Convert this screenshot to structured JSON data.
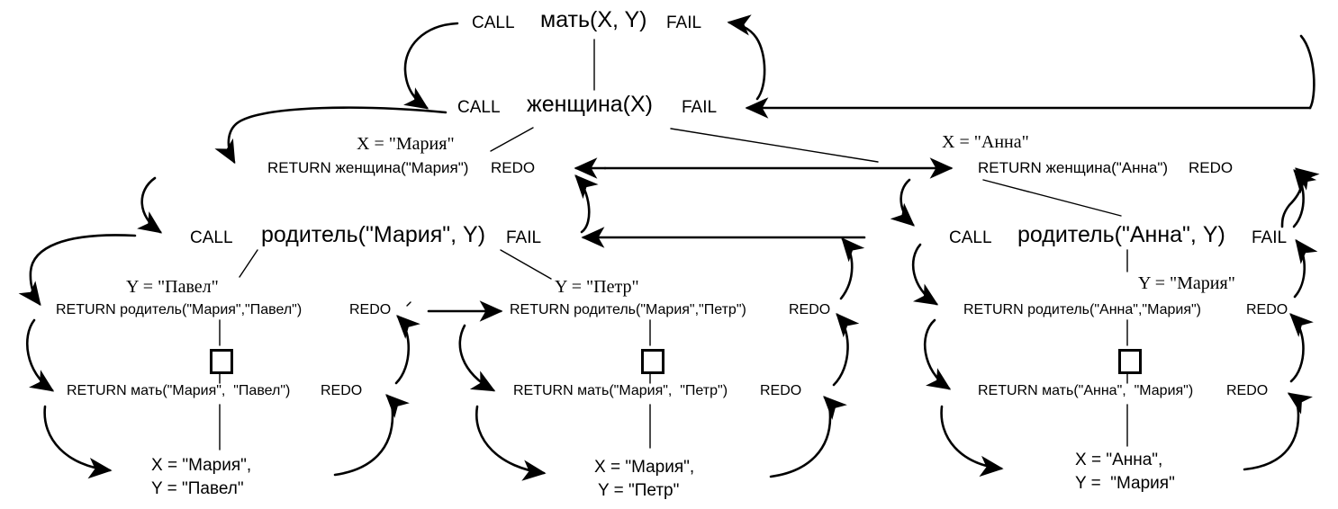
{
  "diagram": {
    "title": "Prolog backtracking execution trace for мать(X, Y)",
    "stroke_color": "#000000",
    "background_color": "#ffffff"
  },
  "keywords": {
    "call": "CALL",
    "fail": "FAIL",
    "redo": "REDO",
    "return": "RETURN"
  },
  "levels": {
    "root": {
      "call": "CALL",
      "goal": "мать(X, Y)",
      "fail": "FAIL"
    },
    "female": {
      "call": "CALL",
      "goal": "женщина(X)",
      "fail": "FAIL"
    }
  },
  "branches": {
    "maria": {
      "binding_x": "X = \"Мария\"",
      "return_female": "RETURN женщина(\"Мария\")",
      "redo_female": "REDO",
      "call": "CALL",
      "goal_parent": "родитель(\"Мария\", Y)",
      "fail_parent": "FAIL",
      "solutions": [
        {
          "binding_y": "Y = \"Павел\"",
          "return_parent": "RETURN родитель(\"Мария\",\"Павел\")",
          "redo_parent": "REDO",
          "return_mother": "RETURN мать(\"Мария\",  \"Павел\")",
          "redo_mother": "REDO",
          "result_line1": "X = \"Мария\",",
          "result_line2": "Y = \"Павел\"",
          "success_box": "empty-goal-box"
        },
        {
          "binding_y": "Y = \"Петр\"",
          "return_parent": "RETURN родитель(\"Мария\",\"Петр\")",
          "redo_parent": "REDO",
          "return_mother": "RETURN мать(\"Мария\",  \"Петр\")",
          "redo_mother": "REDO",
          "result_line1": "X = \"Мария\",",
          "result_line2": "Y = \"Петр\"",
          "success_box": "empty-goal-box"
        }
      ]
    },
    "anna": {
      "binding_x": "X = \"Анна\"",
      "return_female": "RETURN женщина(\"Анна\")",
      "redo_female": "REDO",
      "call": "CALL",
      "goal_parent": "родитель(\"Анна\", Y)",
      "fail_parent": "FAIL",
      "solutions": [
        {
          "binding_y": "Y = \"Мария\"",
          "return_parent": "RETURN родитель(\"Анна\",\"Мария\")",
          "redo_parent": "REDO",
          "return_mother": "RETURN мать(\"Анна\",  \"Мария\")",
          "redo_mother": "REDO",
          "result_line1": "X = \"Анна\",",
          "result_line2": "Y =  \"Мария\"",
          "success_box": "empty-goal-box"
        }
      ]
    }
  }
}
